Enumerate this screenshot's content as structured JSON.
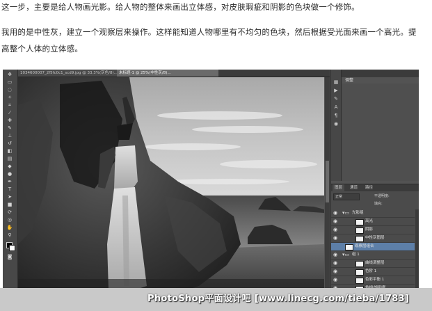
{
  "article": {
    "paragraph_1": "这一步，主要是给人物画光影。给人物的整体来画出立体感，对皮肤瑕疵和阴影的色块做一个修饰。",
    "paragraph_2": "我用的是中性灰，建立一个观察层来操作。这样能知道人物哪里有不均匀的色块，然后根据受光面来画一个高光。提高整个人体的立体感。"
  },
  "photoshop": {
    "doc_tab_1": "1034600007_2f5fc0c1_scd9.jpg @ 33.3%(灰色/8)...",
    "doc_tab_2": "未标题-1 @ 25%(中性灰/8)...",
    "dock_title": "调整",
    "layers_tabs": [
      "图层",
      "通道",
      "路径"
    ],
    "blend_mode": "正常",
    "opacity_label": "不透明度:",
    "fill_label": "填充:",
    "layers": [
      {
        "name": "光影组"
      },
      {
        "name": "高光"
      },
      {
        "name": "阴影"
      },
      {
        "name": "中性灰图层"
      },
      {
        "name": "观察层组合"
      },
      {
        "name": "组 1"
      },
      {
        "name": "曲线调整层"
      },
      {
        "name": "色阶 1"
      },
      {
        "name": "色彩平衡 1"
      },
      {
        "name": "色相/饱和度"
      }
    ]
  },
  "watermark": {
    "text": "PhotoShop平面设计吧 [www.linecg.com/tieba/1783]"
  }
}
